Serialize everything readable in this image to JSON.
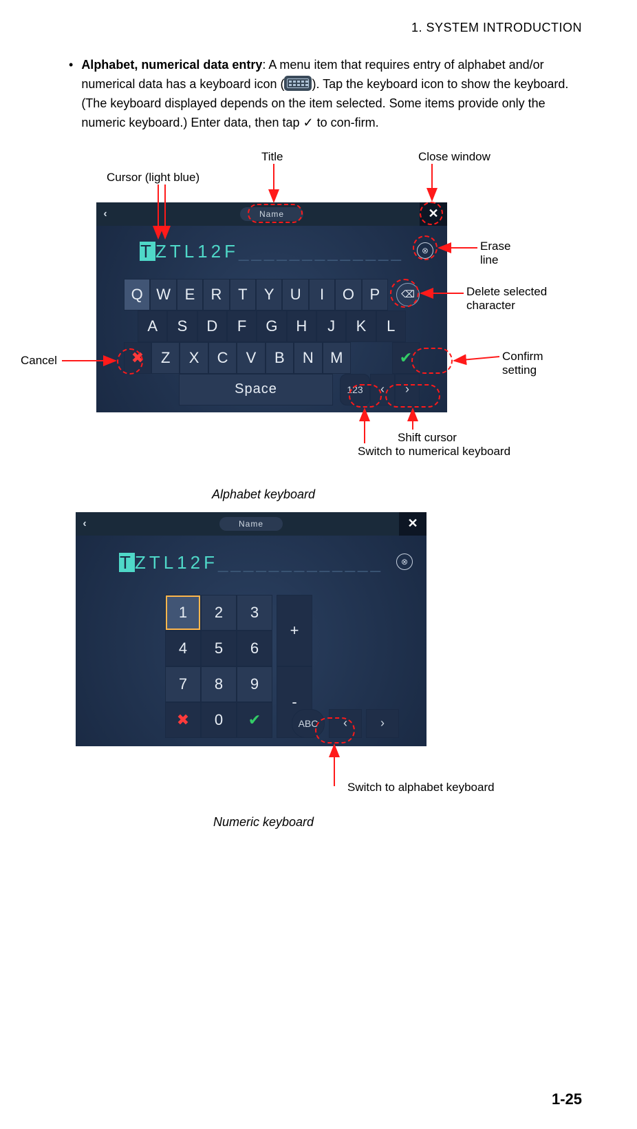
{
  "header": {
    "section": "1.  SYSTEM INTRODUCTION"
  },
  "bullet": {
    "marker": "•",
    "title": "Alphabet, numerical data entry",
    "text_after_title": ": A menu item that requires entry of alphabet and/or numerical data has a keyboard icon (",
    "text_after_icon": "). Tap the keyboard icon to show the keyboard. (The keyboard displayed depends on the item selected. Some items provide only the numeric keyboard.) Enter data, then tap ",
    "check": "✓",
    "text_end": " to con-firm."
  },
  "annotations": {
    "title": "Title",
    "close_window": "Close window",
    "cursor": "Cursor (light blue)",
    "erase_line": "Erase line",
    "delete_char": "Delete selected character",
    "cancel": "Cancel",
    "confirm": "Confirm setting",
    "shift_cursor": "Shift cursor",
    "switch_num": "Switch to numerical keyboard",
    "switch_abc": "Switch to alphabet keyboard"
  },
  "captions": {
    "alpha": "Alphabet keyboard",
    "numeric": "Numeric keyboard"
  },
  "keyboard": {
    "title": "Name",
    "close": "✕",
    "back": "‹",
    "input_cursor": "T",
    "input_rest": "ZTL12F",
    "placeholder": "_____________",
    "erase_icon": "⊗",
    "row1": [
      "Q",
      "W",
      "E",
      "R",
      "T",
      "Y",
      "U",
      "I",
      "O",
      "P"
    ],
    "row2": [
      "A",
      "S",
      "D",
      "F",
      "G",
      "H",
      "J",
      "K",
      "L"
    ],
    "row3": [
      "Z",
      "X",
      "C",
      "V",
      "B",
      "N",
      "M"
    ],
    "cancel": "✖",
    "confirm": "✔",
    "space": "Space",
    "backspace": "⌫",
    "mode_num": "123",
    "mode_abc": "ABC",
    "arrow_left": "‹",
    "arrow_right": "›"
  },
  "numpad": {
    "row1": [
      "1",
      "2",
      "3"
    ],
    "row2": [
      "4",
      "5",
      "6"
    ],
    "row3": [
      "7",
      "8",
      "9"
    ],
    "zero_row": {
      "cancel": "✖",
      "zero": "0",
      "confirm": "✔"
    },
    "plus": "+",
    "minus": "-"
  },
  "page_number": "1-25"
}
